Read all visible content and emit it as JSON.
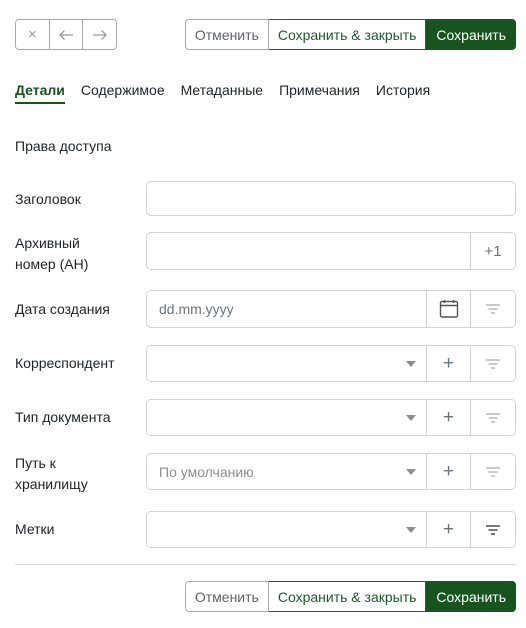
{
  "nav": {
    "close_symbol": "×",
    "icons": [
      "close-icon",
      "arrow-left-icon",
      "arrow-right-icon"
    ]
  },
  "actions": {
    "cancel": "Отменить",
    "save_close": "Сохранить & закрыть",
    "save": "Сохранить"
  },
  "tabs": [
    "Детали",
    "Содержимое",
    "Метаданные",
    "Примечания",
    "История"
  ],
  "permissions_label": "Права доступа",
  "fields": {
    "title": {
      "label": "Заголовок",
      "value": ""
    },
    "asn": {
      "label_line1": "Архивный",
      "label_line2": "номер (АН)",
      "value": "",
      "increment": "+1"
    },
    "created": {
      "label": "Дата создания",
      "placeholder": "dd.mm.yyyy"
    },
    "correspondent": {
      "label": "Корреспондент",
      "value": "",
      "add": "+"
    },
    "doctype": {
      "label": "Тип документа",
      "value": "",
      "add": "+"
    },
    "storage": {
      "label_line1": "Путь к",
      "label_line2": "хранилищу",
      "value": "По умолчанию",
      "add": "+"
    },
    "tags": {
      "label": "Метки",
      "value": "",
      "add": "+"
    }
  },
  "colors": {
    "accent": "#17541f",
    "border": "#cfd3d7"
  }
}
